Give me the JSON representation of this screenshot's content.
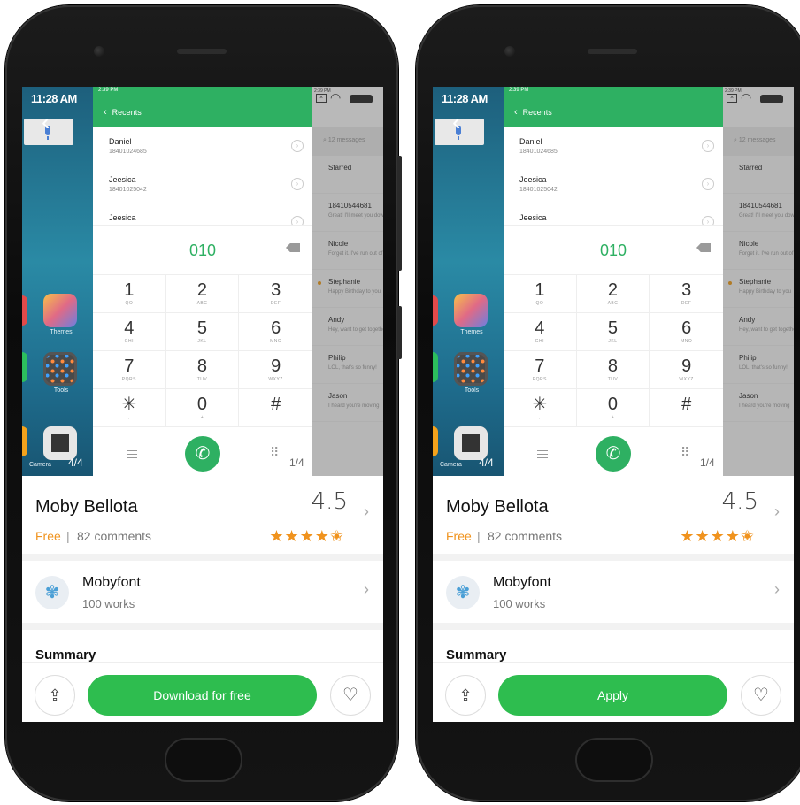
{
  "phones": [
    {
      "carousel": {
        "home_time": "11:28 AM",
        "home_labels": {
          "themes": "Themes",
          "tools": "Tools",
          "camera": "Camera"
        },
        "home_page": "4/4",
        "dialer_status_time": "2:39 PM",
        "dialer_title": "Recents",
        "contacts": [
          {
            "name": "Daniel",
            "phone": "18401024685"
          },
          {
            "name": "Jeesica",
            "phone": "18401025042"
          },
          {
            "name": "Jeesica",
            "phone": ""
          }
        ],
        "dial_number": "010",
        "keys": [
          {
            "digit": "1",
            "sub": "QO"
          },
          {
            "digit": "2",
            "sub": "ABC"
          },
          {
            "digit": "3",
            "sub": "DEF"
          },
          {
            "digit": "4",
            "sub": "GHI"
          },
          {
            "digit": "5",
            "sub": "JKL"
          },
          {
            "digit": "6",
            "sub": "MNO"
          },
          {
            "digit": "7",
            "sub": "PQRS"
          },
          {
            "digit": "8",
            "sub": "TUV"
          },
          {
            "digit": "9",
            "sub": "WXYZ"
          },
          {
            "digit": "✳",
            "sub": ","
          },
          {
            "digit": "0",
            "sub": "+"
          },
          {
            "digit": "#",
            "sub": ""
          }
        ],
        "dialer_page": "1/4",
        "msg_status_time": "2:39 PM",
        "msg_search": "12 messages",
        "messages": [
          {
            "name": "Starred",
            "text": ""
          },
          {
            "name": "18410544681",
            "text": "Great! I'll meet you downstairs"
          },
          {
            "name": "Nicole",
            "text": "Forget it. I've run out of"
          },
          {
            "name": "Stephanie",
            "text": "Happy Birthday to you",
            "unread": true
          },
          {
            "name": "Andy",
            "text": "Hey, want to get together"
          },
          {
            "name": "Philip",
            "text": "LOL, that's so funny!"
          },
          {
            "name": "Jason",
            "text": "I heard you're moving"
          }
        ]
      },
      "app_name": "Moby Bellota",
      "price": "Free",
      "comments": "82 comments",
      "rating": "4.5",
      "stars": "★★★★✬",
      "author_name": "Mobyfont",
      "author_works": "100 works",
      "summary_title": "Summary",
      "main_button": "Download for free"
    },
    {
      "carousel": {
        "home_time": "11:28 AM",
        "home_labels": {
          "themes": "Themes",
          "tools": "Tools",
          "camera": "Camera"
        },
        "home_page": "4/4",
        "dialer_status_time": "2:39 PM",
        "dialer_title": "Recents",
        "contacts": [
          {
            "name": "Daniel",
            "phone": "18401024685"
          },
          {
            "name": "Jeesica",
            "phone": "18401025042"
          },
          {
            "name": "Jeesica",
            "phone": ""
          }
        ],
        "dial_number": "010",
        "keys": [
          {
            "digit": "1",
            "sub": "QO"
          },
          {
            "digit": "2",
            "sub": "ABC"
          },
          {
            "digit": "3",
            "sub": "DEF"
          },
          {
            "digit": "4",
            "sub": "GHI"
          },
          {
            "digit": "5",
            "sub": "JKL"
          },
          {
            "digit": "6",
            "sub": "MNO"
          },
          {
            "digit": "7",
            "sub": "PQRS"
          },
          {
            "digit": "8",
            "sub": "TUV"
          },
          {
            "digit": "9",
            "sub": "WXYZ"
          },
          {
            "digit": "✳",
            "sub": ","
          },
          {
            "digit": "0",
            "sub": "+"
          },
          {
            "digit": "#",
            "sub": ""
          }
        ],
        "dialer_page": "1/4",
        "msg_status_time": "2:39 PM",
        "msg_search": "12 messages",
        "messages": [
          {
            "name": "Starred",
            "text": ""
          },
          {
            "name": "18410544681",
            "text": "Great! I'll meet you downstairs"
          },
          {
            "name": "Nicole",
            "text": "Forget it. I've run out of"
          },
          {
            "name": "Stephanie",
            "text": "Happy Birthday to you",
            "unread": true
          },
          {
            "name": "Andy",
            "text": "Hey, want to get together"
          },
          {
            "name": "Philip",
            "text": "LOL, that's so funny!"
          },
          {
            "name": "Jason",
            "text": "I heard you're moving"
          }
        ]
      },
      "app_name": "Moby Bellota",
      "price": "Free",
      "comments": "82 comments",
      "rating": "4.5",
      "stars": "★★★★✬",
      "author_name": "Mobyfont",
      "author_works": "100 works",
      "summary_title": "Summary",
      "main_button": "Apply"
    }
  ],
  "icons": {
    "share": "share-icon",
    "favorite": "heart-icon",
    "call": "phone-icon",
    "author": "shell-icon",
    "chevron": "chevron-right-icon"
  },
  "colors": {
    "accent_green": "#2ebd4f",
    "dialer_green": "#2eb062",
    "price_orange": "#f0931e"
  }
}
